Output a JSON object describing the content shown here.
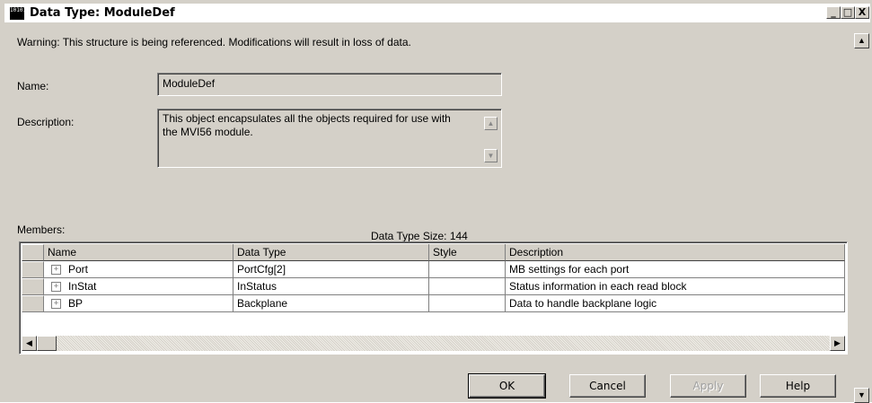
{
  "window": {
    "title": "Data Type: ModuleDef",
    "icon_text": "101010",
    "controls": {
      "minimize": "_",
      "maximize": "□",
      "close": "X"
    }
  },
  "warning": "Warning: This structure is being referenced.  Modifications will result in loss of data.",
  "form": {
    "name_label": "Name:",
    "name_value": "ModuleDef",
    "description_label": "Description:",
    "description_value": "This object encapsulates all the objects required for use with the MVI56 module.",
    "members_label": "Members:",
    "data_type_size": "Data Type Size: 144"
  },
  "grid": {
    "columns": [
      "Name",
      "Data Type",
      "Style",
      "Description"
    ],
    "rows": [
      {
        "expander": "+",
        "name": "Port",
        "data_type": "PortCfg[2]",
        "style": "",
        "description": "MB settings for each port"
      },
      {
        "expander": "+",
        "name": "InStat",
        "data_type": "InStatus",
        "style": "",
        "description": "Status information in each read block"
      },
      {
        "expander": "+",
        "name": "BP",
        "data_type": "Backplane",
        "style": "",
        "description": "Data to handle backplane logic"
      }
    ]
  },
  "buttons": {
    "ok": "OK",
    "cancel": "Cancel",
    "apply": "Apply",
    "help": "Help"
  },
  "glyphs": {
    "arrow_left": "◀",
    "arrow_right": "▶",
    "arrow_up": "▲",
    "arrow_down": "▼"
  }
}
